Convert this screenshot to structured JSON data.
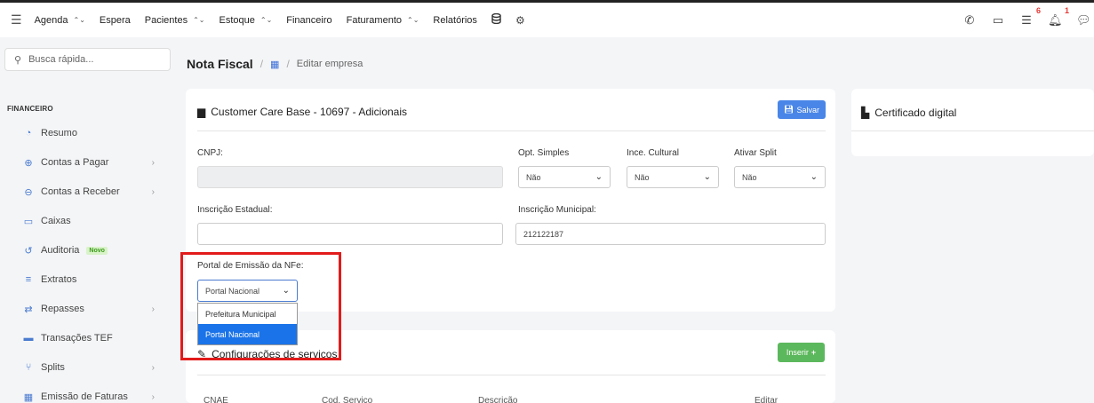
{
  "topbar": {
    "nav": [
      {
        "label": "Agenda",
        "has_toggle": true
      },
      {
        "label": "Espera",
        "has_toggle": false
      },
      {
        "label": "Pacientes",
        "has_toggle": true
      },
      {
        "label": "Estoque",
        "has_toggle": true
      },
      {
        "label": "Financeiro",
        "has_toggle": false
      },
      {
        "label": "Faturamento",
        "has_toggle": true
      },
      {
        "label": "Relatórios",
        "has_toggle": false
      }
    ],
    "badges": {
      "tasks": "6",
      "notifications": "1"
    }
  },
  "sidebar": {
    "search_placeholder": "Busca rápida...",
    "section": "FINANCEIRO",
    "items": [
      {
        "label": "Resumo",
        "icon": "pie-chart-icon"
      },
      {
        "label": "Contas a Pagar",
        "icon": "arrow-up-circle-icon"
      },
      {
        "label": "Contas a Receber",
        "icon": "arrow-down-circle-icon"
      },
      {
        "label": "Caixas",
        "icon": "inbox-icon"
      },
      {
        "label": "Auditoria",
        "icon": "history-icon",
        "tag": "Novo"
      },
      {
        "label": "Extratos",
        "icon": "list-icon"
      },
      {
        "label": "Repasses",
        "icon": "transfer-icon"
      },
      {
        "label": "Transações TEF",
        "icon": "card-icon"
      },
      {
        "label": "Splits",
        "icon": "split-icon"
      },
      {
        "label": "Emissão de Faturas",
        "icon": "invoice-icon"
      }
    ]
  },
  "header": {
    "title": "Nota Fiscal",
    "subtitle": "Editar empresa"
  },
  "main_card": {
    "title": "Customer Care Base - 10697 - Adicionais",
    "save_label": "Salvar",
    "cnpj_label": "CNPJ:",
    "cnpj_value": "",
    "opt_simples_label": "Opt. Simples",
    "opt_simples_value": "Não",
    "ince_cultural_label": "Ince. Cultural",
    "ince_cultural_value": "Não",
    "ativar_split_label": "Ativar Split",
    "ativar_split_value": "Não",
    "insc_estadual_label": "Inscrição Estadual:",
    "insc_estadual_value": "",
    "insc_municipal_label": "Inscrição Municipal:",
    "insc_municipal_value": "212122187",
    "portal_label": "Portal de Emissão da NFe:",
    "portal_value": "Portal Nacional",
    "portal_options": [
      "Prefeitura Municipal",
      "Portal Nacional"
    ]
  },
  "cert_card": {
    "title": "Certificado digital"
  },
  "services_card": {
    "title": "Configurações de serviços",
    "insert_label": "Inserir",
    "columns": [
      "CNAE",
      "Cod. Serviço",
      "Descrição",
      "Editar"
    ]
  }
}
